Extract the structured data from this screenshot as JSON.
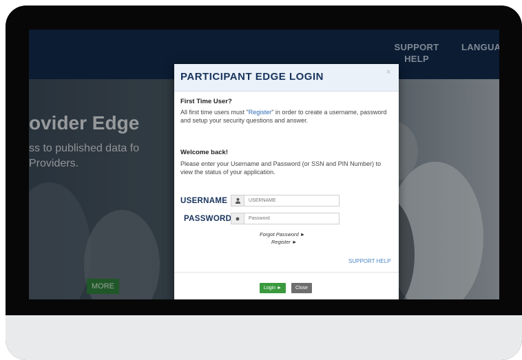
{
  "nav": {
    "support_line1": "SUPPORT",
    "support_line2": "HELP",
    "language": "LANGUA"
  },
  "hero": {
    "title": "ovider Edge",
    "subtitle_line1": "ss to published data fo",
    "subtitle_line2": "Providers.",
    "more_label": "MORE"
  },
  "modal": {
    "title": "PARTICIPANT EDGE LOGIN",
    "close_glyph": "×",
    "first_time_heading": "First Time User?",
    "first_time_prefix": "All first time users must \"",
    "first_time_link": "Register",
    "first_time_suffix": "\" in order to create a username, password and setup your security questions and answer.",
    "welcome_heading": "Welcome back!",
    "welcome_text": "Please enter your Username and Password (or SSN and PIN Number) to view the status of your application.",
    "username_label": "USERNAME",
    "username_placeholder": "USERNAME",
    "password_label": "PASSWORD",
    "password_placeholder": "Password",
    "forgot_password": "Forgot Password ►",
    "register": "Register ►",
    "support_help": "SUPPORT HELP",
    "login_button": "Login ►",
    "close_button": "Close"
  },
  "colors": {
    "navbar": "#10294a",
    "modal_title": "#17335c",
    "login_button": "#3a9a3e",
    "close_button": "#6e6e6e",
    "more_button": "#2f7d3a"
  },
  "icons": {
    "username_addon": "user-icon",
    "password_addon": "asterisk-icon"
  }
}
